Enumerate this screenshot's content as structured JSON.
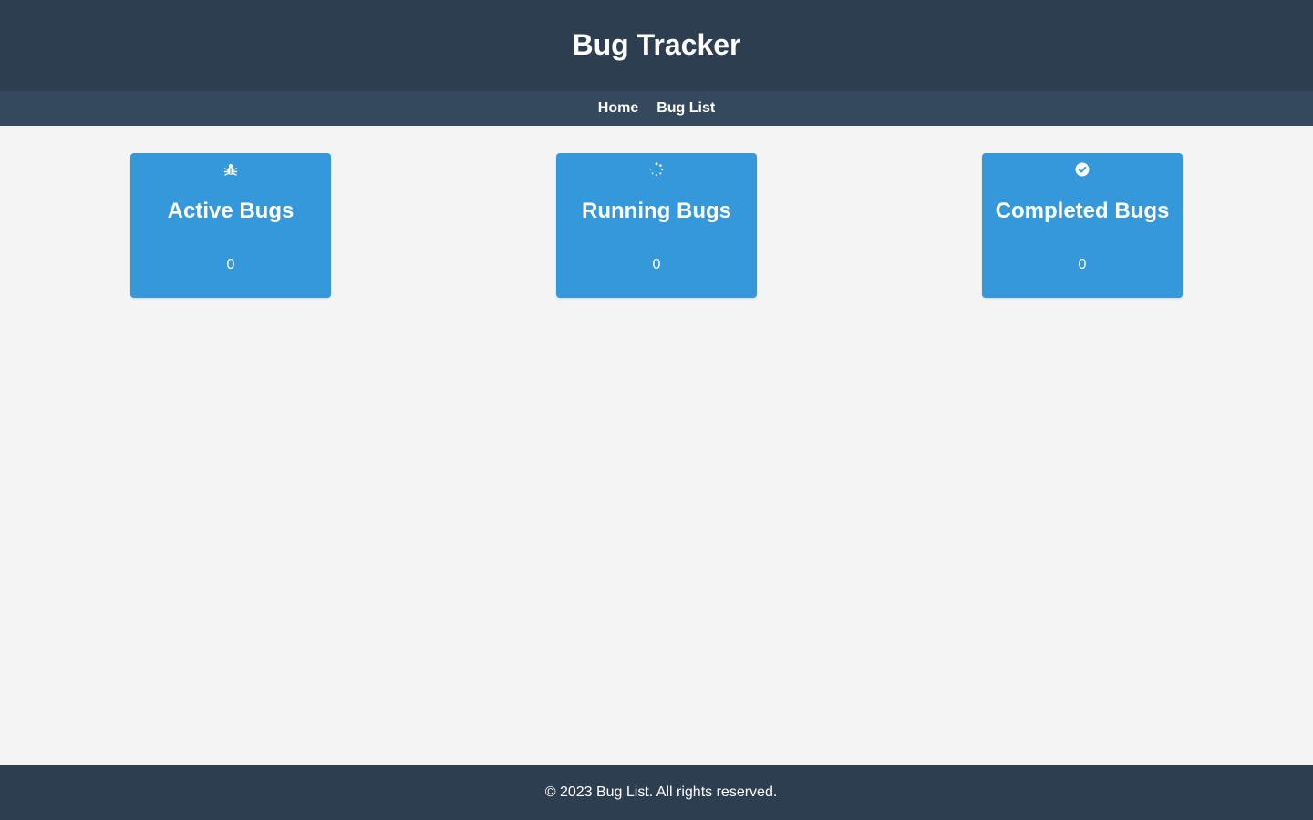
{
  "header": {
    "title": "Bug Tracker"
  },
  "nav": {
    "items": [
      {
        "label": "Home"
      },
      {
        "label": "Bug List"
      }
    ]
  },
  "cards": [
    {
      "icon": "bug-icon",
      "title": "Active Bugs",
      "count": "0"
    },
    {
      "icon": "spinner-icon",
      "title": "Running Bugs",
      "count": "0"
    },
    {
      "icon": "check-circle-icon",
      "title": "Completed Bugs",
      "count": "0"
    }
  ],
  "footer": {
    "text": "© 2023 Bug List. All rights reserved."
  },
  "colors": {
    "header_bg": "#2d3e50",
    "nav_bg": "#34495e",
    "card_bg": "#3498db",
    "page_bg": "#f4f4f5",
    "text_light": "#ffffff"
  }
}
